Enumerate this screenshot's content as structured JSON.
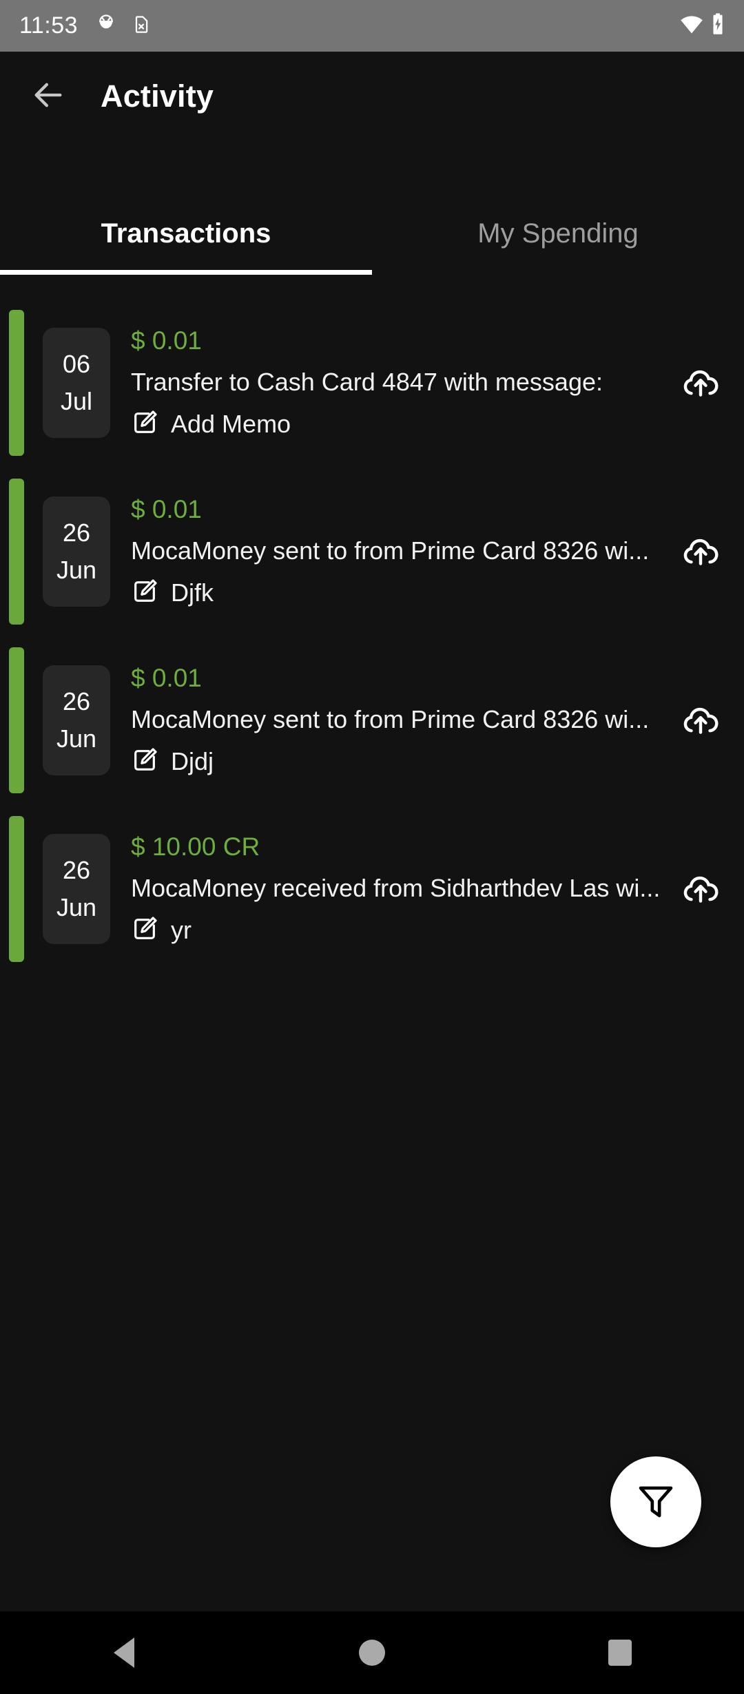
{
  "status_bar": {
    "time": "11:53",
    "icons": [
      "android-debug-icon",
      "sim-card-missing-icon",
      "wifi-icon",
      "battery-charging-icon"
    ]
  },
  "toolbar": {
    "back_icon": "arrow-left-icon",
    "title": "Activity"
  },
  "tabs": [
    {
      "label": "Transactions",
      "active": true
    },
    {
      "label": "My Spending",
      "active": false
    }
  ],
  "transactions": [
    {
      "day": "06",
      "month": "Jul",
      "amount": "$ 0.01",
      "description": "Transfer to Cash Card 4847 with message:",
      "memo": "Add Memo",
      "memo_icon": "edit-icon",
      "action_icon": "cloud-upload-icon",
      "accent_color": "#6aa83c"
    },
    {
      "day": "26",
      "month": "Jun",
      "amount": "$ 0.01",
      "description": "MocaMoney sent to  from Prime Card 8326 wi...",
      "memo": "Djfk",
      "memo_icon": "edit-icon",
      "action_icon": "cloud-upload-icon",
      "accent_color": "#6aa83c"
    },
    {
      "day": "26",
      "month": "Jun",
      "amount": "$ 0.01",
      "description": "MocaMoney sent to  from Prime Card 8326 wi...",
      "memo": "Djdj",
      "memo_icon": "edit-icon",
      "action_icon": "cloud-upload-icon",
      "accent_color": "#6aa83c"
    },
    {
      "day": "26",
      "month": "Jun",
      "amount": "$ 10.00 CR",
      "description": "MocaMoney received from Sidharthdev Las wi...",
      "memo": "yr",
      "memo_icon": "edit-icon",
      "action_icon": "cloud-upload-icon",
      "accent_color": "#6aa83c"
    }
  ],
  "fab": {
    "icon": "filter-funnel-icon"
  },
  "nav_bar": {
    "back": "nav-back-triangle",
    "home": "nav-home-circle",
    "recents": "nav-recents-square"
  },
  "colors": {
    "background": "#121212",
    "status_bar": "#757575",
    "accent_green": "#6aa83c",
    "amount_green": "#6eae3c",
    "tab_active": "#ffffff",
    "tab_inactive": "#9e9e9e",
    "date_chip": "#272727"
  }
}
